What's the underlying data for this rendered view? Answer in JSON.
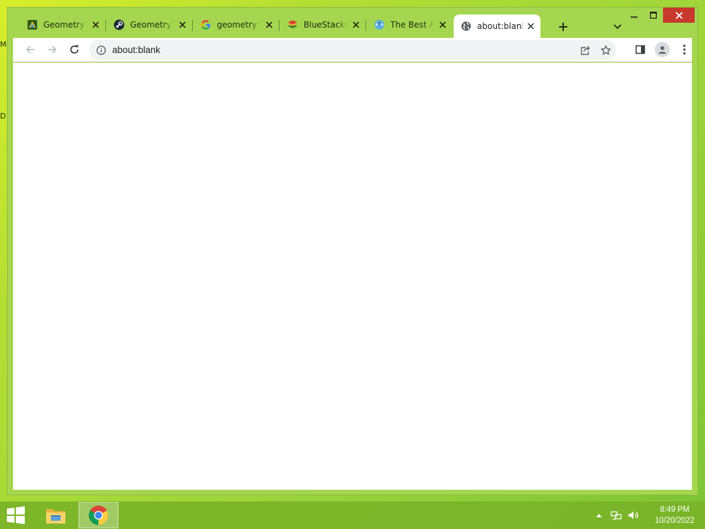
{
  "desktop": {
    "edge_letters": [
      "M",
      "D"
    ]
  },
  "browser": {
    "tabs": [
      {
        "title": "Geometry Dash",
        "icon": "geometry-dash-icon",
        "active": false
      },
      {
        "title": "Geometry Dash",
        "icon": "steam-icon",
        "active": false
      },
      {
        "title": "geometry dash",
        "icon": "google-icon",
        "active": false
      },
      {
        "title": "BlueStacks",
        "icon": "bluestacks-icon",
        "active": false
      },
      {
        "title": "The Best Android",
        "icon": "web-icon",
        "active": false
      },
      {
        "title": "about:blank",
        "icon": "globe-icon",
        "active": true
      }
    ],
    "new_tab_label": "New tab",
    "address": "about:blank",
    "window_controls": [
      "minimize",
      "maximize",
      "close"
    ],
    "toolbar_icons": [
      "back-icon",
      "forward-icon",
      "reload-icon",
      "share-icon",
      "star-icon",
      "side-panel-icon",
      "profile-icon",
      "menu-icon"
    ]
  },
  "taskbar": {
    "apps": [
      {
        "name": "File Explorer",
        "icon": "file-explorer-icon",
        "active": false
      },
      {
        "name": "Google Chrome",
        "icon": "chrome-icon",
        "active": true
      }
    ],
    "clock": {
      "time": "8:49 PM",
      "date": "10/20/2022"
    }
  },
  "colors": {
    "desktop_accent": "#a6d64f",
    "taskbar": "#7ab328",
    "close_button": "#c7382d"
  }
}
